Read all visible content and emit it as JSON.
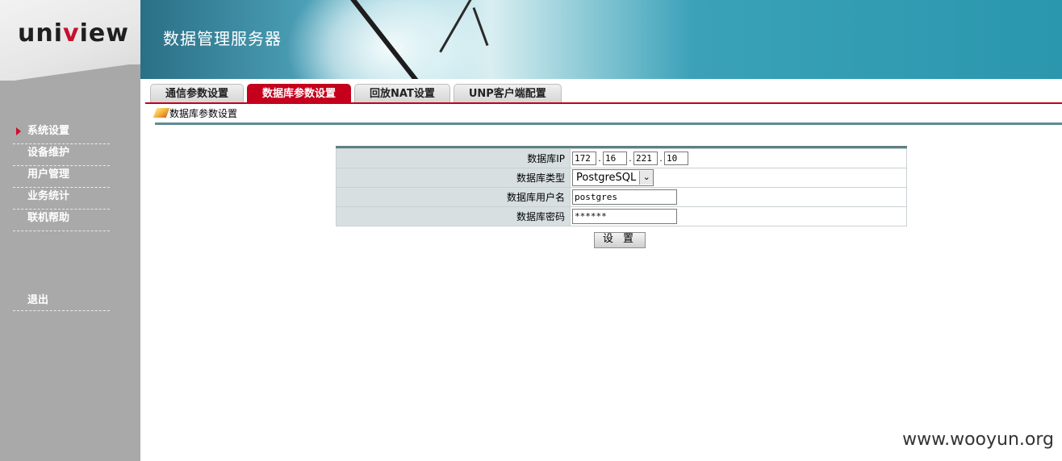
{
  "brand": {
    "logo_part1": "uni",
    "logo_part2": "v",
    "logo_part3": "iew",
    "accent_color": "#c8102e"
  },
  "header": {
    "title": "数据管理服务器"
  },
  "sidebar": {
    "items": [
      {
        "label": "系统设置",
        "active": true
      },
      {
        "label": "设备维护"
      },
      {
        "label": "用户管理"
      },
      {
        "label": "业务统计"
      },
      {
        "label": "联机帮助"
      }
    ],
    "logout_label": "退出"
  },
  "tabs": [
    {
      "label": "通信参数设置"
    },
    {
      "label": "数据库参数设置",
      "active": true
    },
    {
      "label": "回放NAT设置"
    },
    {
      "label": "UNP客户端配置"
    }
  ],
  "section": {
    "title": "数据库参数设置"
  },
  "form": {
    "db_ip_label": "数据库IP",
    "db_ip": [
      "172",
      "16",
      "221",
      "10"
    ],
    "db_type_label": "数据库类型",
    "db_type": "PostgreSQL",
    "db_user_label": "数据库用户名",
    "db_user": "postgres",
    "db_password_label": "数据库密码",
    "db_password": "******",
    "submit_label": "设 置"
  },
  "watermark": "www.wooyun.org"
}
